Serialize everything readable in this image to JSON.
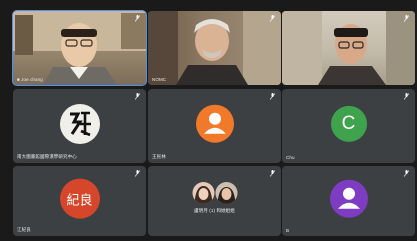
{
  "meeting": {
    "tiles": [
      {
        "name": "chang",
        "label_prefix": "■ Joe chang"
      },
      {
        "name": "NOMC"
      },
      {
        "name": ""
      },
      {
        "name": "南大圖書館國際漢學研究中心"
      },
      {
        "name": "王民林"
      },
      {
        "name": "Chu",
        "avatar_letter": "C"
      },
      {
        "name": "江紀良",
        "avatar_text": "紀良"
      },
      {
        "name": "盧明月 (1) 和她姐姐"
      },
      {
        "name": "B"
      }
    ]
  },
  "colors": {
    "background": "#1a1a1a",
    "tile": "#3c4043",
    "active_speaker_border": "#4f8ff0",
    "avatar_orange": "#f07a2a",
    "avatar_green": "#3fa34d",
    "avatar_red": "#d6462a",
    "avatar_purple": "#7e3cc2"
  }
}
